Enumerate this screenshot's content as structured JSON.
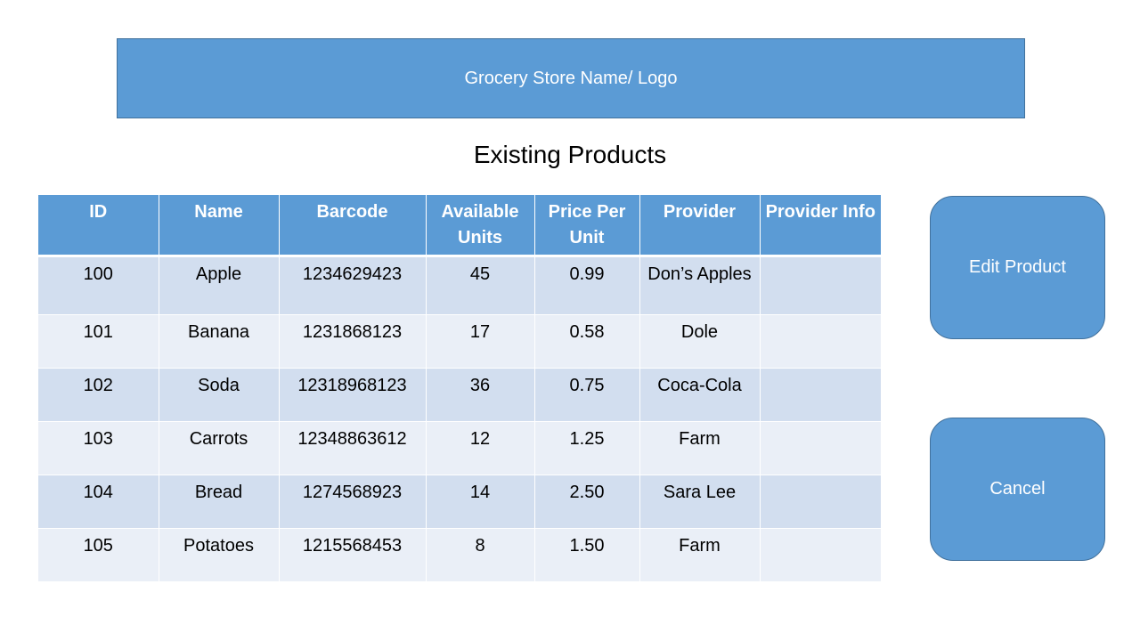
{
  "header": {
    "store_label": "Grocery Store Name/ Logo"
  },
  "main": {
    "title": "Existing Products"
  },
  "table": {
    "columns": [
      "ID",
      "Name",
      "Barcode",
      "Available Units",
      "Price Per Unit",
      "Provider",
      "Provider Info"
    ],
    "rows": [
      {
        "id": "100",
        "name": "Apple",
        "barcode": "1234629423",
        "units": "45",
        "price": "0.99",
        "provider": "Don’s Apples",
        "provider_info": ""
      },
      {
        "id": "101",
        "name": "Banana",
        "barcode": "1231868123",
        "units": "17",
        "price": "0.58",
        "provider": "Dole",
        "provider_info": ""
      },
      {
        "id": "102",
        "name": "Soda",
        "barcode": "12318968123",
        "units": "36",
        "price": "0.75",
        "provider": "Coca-Cola",
        "provider_info": ""
      },
      {
        "id": "103",
        "name": "Carrots",
        "barcode": "12348863612",
        "units": "12",
        "price": "1.25",
        "provider": "Farm",
        "provider_info": ""
      },
      {
        "id": "104",
        "name": "Bread",
        "barcode": "1274568923",
        "units": "14",
        "price": "2.50",
        "provider": "Sara Lee",
        "provider_info": ""
      },
      {
        "id": "105",
        "name": "Potatoes",
        "barcode": "1215568453",
        "units": "8",
        "price": "1.50",
        "provider": "Farm",
        "provider_info": ""
      }
    ]
  },
  "actions": {
    "edit_label": "Edit Product",
    "cancel_label": "Cancel"
  },
  "colors": {
    "accent": "#5b9bd5",
    "accent_border": "#41719c",
    "row_dark": "#d2deef",
    "row_light": "#eaeff7"
  }
}
